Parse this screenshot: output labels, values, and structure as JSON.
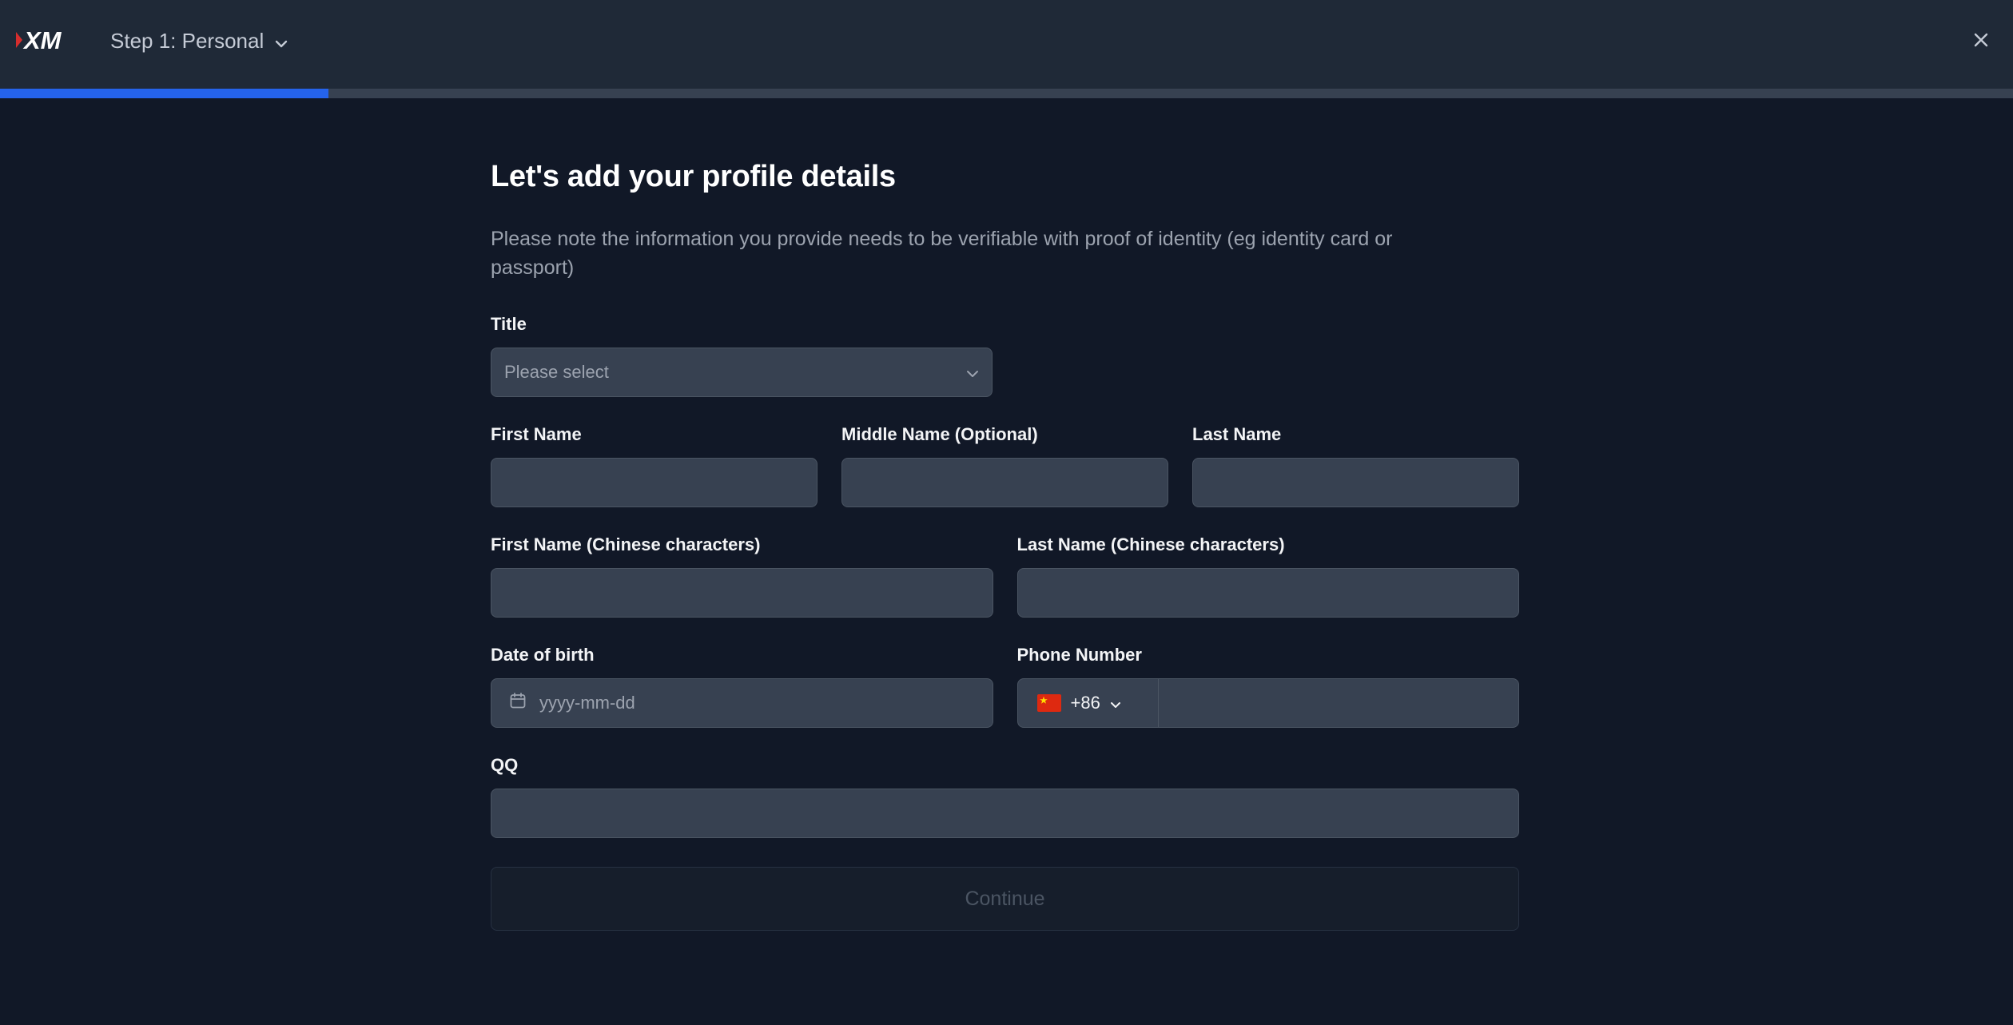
{
  "header": {
    "logo_text": "XM",
    "step_label": "Step 1: Personal",
    "progress_fraction": 0.163,
    "colors": {
      "header_bg": "#1f2937",
      "progress": "#2563eb",
      "logo_accent": "#d62d2d"
    }
  },
  "form": {
    "title": "Let's add your profile details",
    "subtitle": "Please note the information you provide needs to be verifiable with proof of identity (eg identity card or passport)",
    "title_field": {
      "label": "Title",
      "placeholder": "Please select"
    },
    "first_name": {
      "label": "First Name"
    },
    "middle_name": {
      "label": "Middle Name (Optional)"
    },
    "last_name": {
      "label": "Last Name"
    },
    "first_name_cn": {
      "label": "First Name (Chinese characters)"
    },
    "last_name_cn": {
      "label": "Last Name (Chinese characters)"
    },
    "dob": {
      "label": "Date of birth",
      "placeholder": "yyyy-mm-dd",
      "icon": "calendar-icon"
    },
    "phone": {
      "label": "Phone Number",
      "country_code": "+86",
      "flag": "china-flag-icon"
    },
    "qq": {
      "label": "QQ"
    },
    "continue_label": "Continue"
  }
}
